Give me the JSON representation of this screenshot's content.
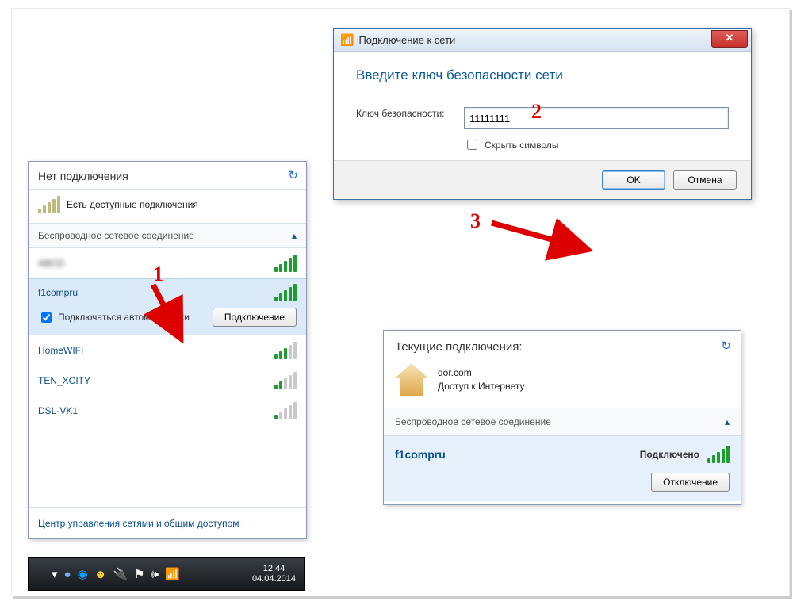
{
  "annotations": {
    "n1": "1",
    "n2": "2",
    "n3": "3"
  },
  "popup": {
    "title": "Нет подключения",
    "available_label": "Есть доступные подключения",
    "section_title": "Беспроводное сетевое соединение",
    "hidden_ssid": "ABCD",
    "selected_ssid": "f1compru",
    "auto_connect_label": "Подключаться автоматически",
    "connect_btn": "Подключение",
    "ssid_2": "HomeWIFI",
    "ssid_3": "TEN_XCITY",
    "ssid_4": "DSL-VK1",
    "footer": "Центр управления сетями и общим доступом"
  },
  "taskbar": {
    "time": "12:44",
    "date": "04.04.2014"
  },
  "dialog": {
    "title": "Подключение к сети",
    "instruction": "Введите ключ безопасности сети",
    "key_label": "Ключ безопасности:",
    "key_value": "11111111",
    "hide_label": "Скрыть символы",
    "ok": "OK",
    "cancel": "Отмена"
  },
  "current": {
    "header": "Текущие подключения:",
    "network_name": "dor.com",
    "network_status": "Доступ к Интернету",
    "section_title": "Беспроводное сетевое соединение",
    "ssid": "f1compru",
    "state": "Подключено",
    "disconnect_btn": "Отключение"
  }
}
